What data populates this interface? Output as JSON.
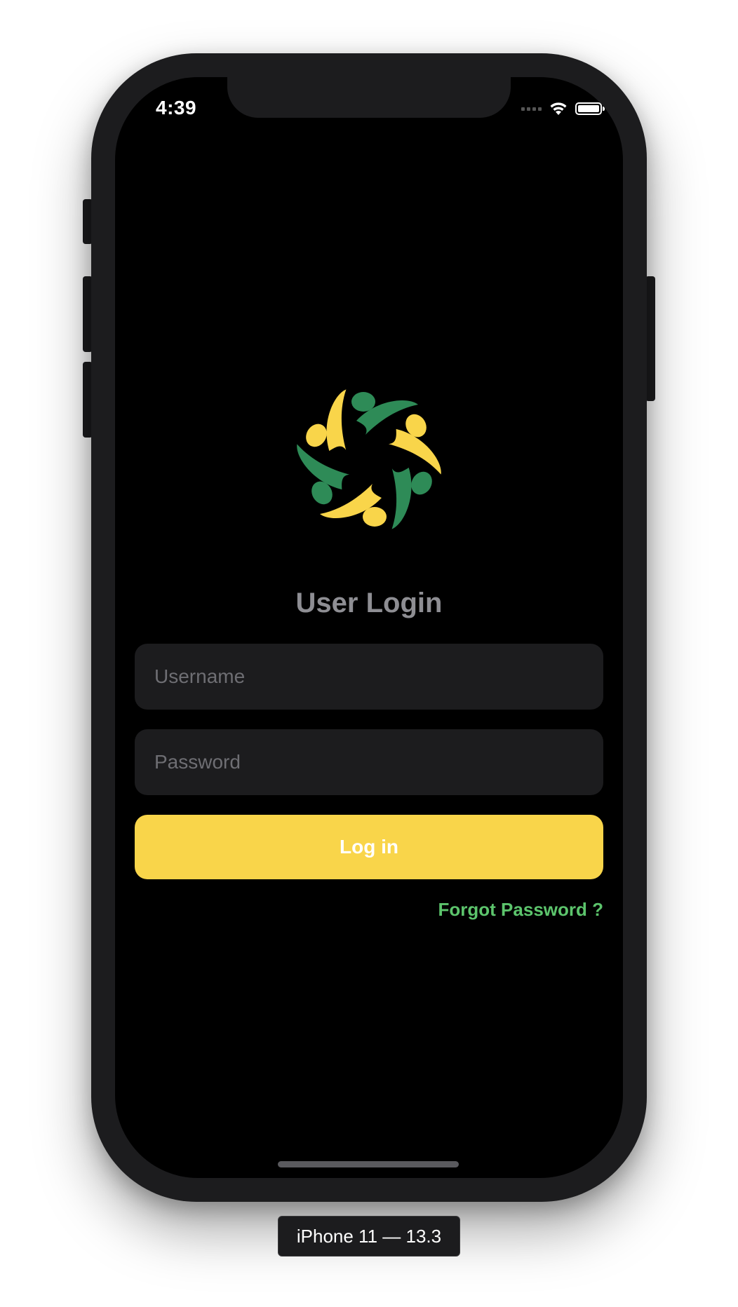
{
  "status_bar": {
    "time": "4:39",
    "icons": [
      "cellular-signal-icon",
      "wifi-icon",
      "battery-icon"
    ]
  },
  "login": {
    "title": "User Login",
    "username_placeholder": "Username",
    "password_placeholder": "Password",
    "login_button": "Log in",
    "forgot_password": "Forgot Password ?"
  },
  "logo": {
    "icon": "people-circle-logo",
    "colors": [
      "#2e8b57",
      "#f9d54a"
    ]
  },
  "simulator": {
    "device_label": "iPhone 11 — 13.3"
  },
  "colors": {
    "background": "#000000",
    "field_background": "#1c1c1e",
    "accent_yellow": "#f9d54a",
    "accent_green": "#5cc46c",
    "title_gray": "#8e8e93"
  }
}
